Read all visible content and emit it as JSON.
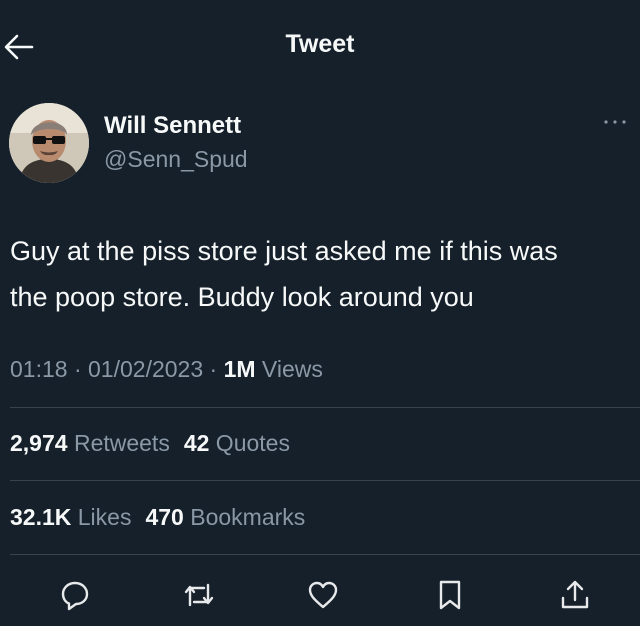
{
  "header": {
    "title": "Tweet",
    "back_icon": "arrow-left-icon"
  },
  "author": {
    "name": "Will Sennett",
    "handle": "@Senn_Spud"
  },
  "tweet": {
    "text_line1": "Guy at the piss store just asked me if this was",
    "text_line2": "the poop store. Buddy look around you"
  },
  "meta": {
    "time": "01:18",
    "sep1": " · ",
    "date": "01/02/2023",
    "sep2": " · ",
    "views_count": "1M",
    "views_label": " Views"
  },
  "stats": {
    "retweets_count": "2,974",
    "retweets_label": " Retweets",
    "quotes_count": "42",
    "quotes_label": " Quotes",
    "likes_count": "32.1K",
    "likes_label": " Likes",
    "bookmarks_count": "470",
    "bookmarks_label": " Bookmarks"
  },
  "actions": [
    "reply-icon",
    "retweet-icon",
    "like-icon",
    "bookmark-icon",
    "share-icon"
  ],
  "colors": {
    "background": "#15202b",
    "text": "#e7e9ea",
    "secondary": "#8b98a5",
    "divider": "#38444d"
  }
}
